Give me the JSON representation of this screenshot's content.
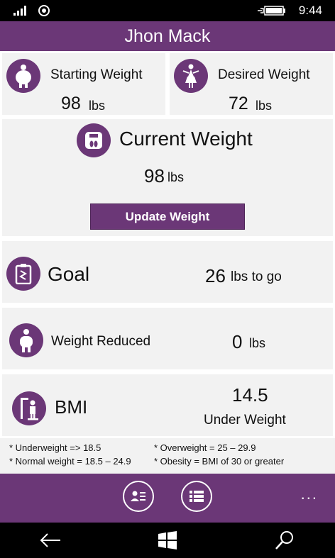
{
  "status": {
    "time": "9:44"
  },
  "header": {
    "title": "Jhon Mack"
  },
  "starting": {
    "label": "Starting Weight",
    "value": "98",
    "unit": "lbs"
  },
  "desired": {
    "label": "Desired Weight",
    "value": "72",
    "unit": "lbs"
  },
  "current": {
    "label": "Current Weight",
    "value": "98",
    "unit": "lbs",
    "button": "Update Weight"
  },
  "goal": {
    "label": "Goal",
    "value": "26",
    "unit": "lbs to go"
  },
  "reduced": {
    "label": "Weight Reduced",
    "value": "0",
    "unit": "lbs"
  },
  "bmi": {
    "label": "BMI",
    "value": "14.5",
    "category": "Under Weight"
  },
  "notes": {
    "underweight": "* Underweight => 18.5",
    "normal": "* Normal weight = 18.5 – 24.9",
    "overweight": "* Overweight = 25 – 29.9",
    "obesity": "* Obesity = BMI of 30 or greater"
  },
  "appbar": {
    "more": "..."
  },
  "icons": {
    "signal": "signal-icon",
    "wifi": "wifi-icon",
    "battery": "battery-icon",
    "starting": "heavy-person-icon",
    "desired": "slim-person-icon",
    "current": "scale-icon",
    "goal": "clipboard-icon",
    "reduced": "body-icon",
    "bmi": "bmi-scale-icon",
    "profile": "profile-card-icon",
    "list": "list-icon",
    "back": "back-arrow-icon",
    "home": "windows-icon",
    "search": "search-icon"
  },
  "colors": {
    "accent": "#6b3777",
    "card": "#f2f2f2"
  }
}
